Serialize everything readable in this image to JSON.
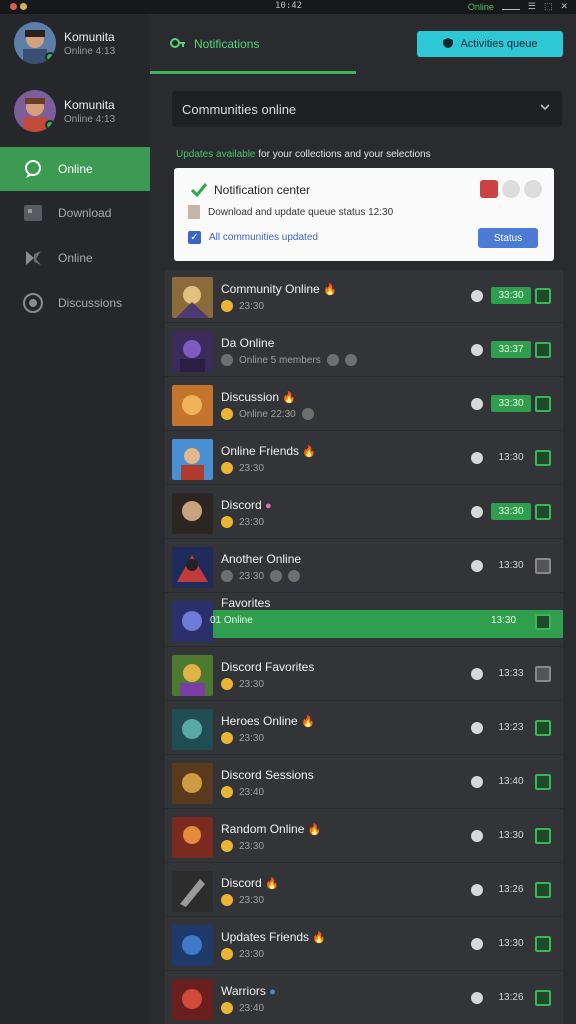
{
  "system_bar": {
    "time": "10:42",
    "status": "Online",
    "colors": {
      "green": "#4cc36a"
    }
  },
  "sidebar": {
    "profiles": [
      {
        "name": "Komunita",
        "sub": "Online 4:13"
      },
      {
        "name": "Komunita",
        "sub": "Online 4:13"
      }
    ],
    "items": [
      {
        "label": "Online",
        "icon": "chat-bubble-icon",
        "active": true
      },
      {
        "label": "Download",
        "icon": "download-box-icon",
        "active": false
      },
      {
        "label": "Online",
        "icon": "tools-icon",
        "active": false
      },
      {
        "label": "Discussions",
        "icon": "globe-icon",
        "active": false
      }
    ]
  },
  "topbar": {
    "tab_label": "Notifications",
    "button_label": "Activities queue"
  },
  "search": {
    "value": "Communities online"
  },
  "notice": {
    "highlight": "Updates available",
    "text": "for your collections and your selections"
  },
  "card": {
    "title": "Notification center",
    "line": "Download and update queue status 12:30",
    "link": "All communities updated",
    "button": "Status"
  },
  "list": {
    "rows": [
      {
        "name": "Community Online",
        "sub": "23:30",
        "value": "33:30",
        "green": true,
        "checked": true
      },
      {
        "name": "Da Online",
        "sub": "Online 5 members",
        "value": "33:37",
        "green": true,
        "checked": true
      },
      {
        "name": "Discussion",
        "sub": "Online 22:30",
        "value": "33:30",
        "green": true,
        "checked": true
      },
      {
        "name": "Online Friends",
        "sub": "23:30",
        "value": "13:30",
        "green": false,
        "checked": true
      },
      {
        "name": "Discord",
        "sub": "23:30",
        "value": "33:30",
        "green": true,
        "checked": true
      },
      {
        "name": "Another Online",
        "sub": "23:30",
        "value": "13:30",
        "green": false,
        "checked": false
      },
      {
        "name": "Favorites",
        "sub": "01 Online",
        "value": "13:30",
        "green": false,
        "checked": true,
        "highlight": true
      },
      {
        "name": "Discord Favorites",
        "sub": "23:30",
        "value": "13:33",
        "green": false,
        "checked": false
      },
      {
        "name": "Heroes Online",
        "sub": "23:30",
        "value": "13:23",
        "green": false,
        "checked": true
      },
      {
        "name": "Discord Sessions",
        "sub": "23:40",
        "value": "13:40",
        "green": false,
        "checked": true
      },
      {
        "name": "Random Online",
        "sub": "23:30",
        "value": "13:30",
        "green": false,
        "checked": true
      },
      {
        "name": "Discord",
        "sub": "23:30",
        "value": "13:26",
        "green": false,
        "checked": true
      },
      {
        "name": "Updates Friends",
        "sub": "23:30",
        "value": "13:30",
        "green": false,
        "checked": true
      },
      {
        "name": "Warriors",
        "sub": "23:40",
        "value": "13:26",
        "green": false,
        "checked": true
      }
    ]
  }
}
